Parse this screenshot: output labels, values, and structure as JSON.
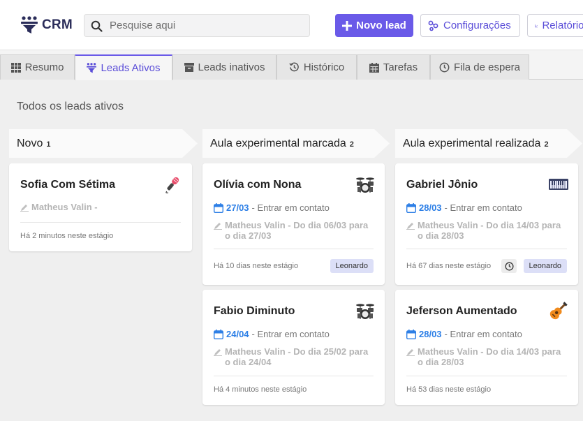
{
  "header": {
    "logo_text": "CRM",
    "search_placeholder": "Pesquise aqui",
    "new_lead_label": "Novo lead",
    "config_label": "Configurações",
    "reports_label": "Relatórios"
  },
  "tabs": [
    {
      "label": "Resumo",
      "icon": "grid-icon"
    },
    {
      "label": "Leads Ativos",
      "icon": "funnel-people-icon",
      "active": true
    },
    {
      "label": "Leads inativos",
      "icon": "archive-icon"
    },
    {
      "label": "Histórico",
      "icon": "history-icon"
    },
    {
      "label": "Tarefas",
      "icon": "calendar-icon"
    },
    {
      "label": "Fila de espera",
      "icon": "clock-icon"
    }
  ],
  "page_title": "Todos os leads ativos",
  "columns": [
    {
      "title": "Novo",
      "count": "1",
      "cards": [
        {
          "name": "Sofia Com Sétima",
          "icon": "microphone-icon",
          "owner": "Matheus Valin -",
          "footer": "Há 2 minutos neste estágio"
        }
      ]
    },
    {
      "title": "Aula experimental marcada",
      "count": "2",
      "cards": [
        {
          "name": "Olívia com Nona",
          "icon": "drums-icon",
          "date": "27/03",
          "action": "- Entrar em contato",
          "owner": "Matheus Valin - Do dia 06/03 para o dia 27/03",
          "footer": "Há 10 dias neste estágio",
          "badge": "Leonardo"
        },
        {
          "name": "Fabio Diminuto",
          "icon": "drums-icon",
          "date": "24/04",
          "action": "- Entrar em contato",
          "owner": "Matheus Valin - Do dia 25/02 para o dia 24/04",
          "footer": "Há 4 minutos neste estágio"
        }
      ]
    },
    {
      "title": "Aula experimental realizada",
      "count": "2",
      "cards": [
        {
          "name": "Gabriel Jônio",
          "icon": "keyboard-icon",
          "date": "28/03",
          "action": "- Entrar em contato",
          "owner": "Matheus Valin - Do dia 14/03 para o dia 28/03",
          "footer": "Há 67 dias neste estágio",
          "badge": "Leonardo",
          "has_clock": true
        },
        {
          "name": "Jeferson Aumentado",
          "icon": "guitar-icon",
          "date": "28/03",
          "action": "- Entrar em contato",
          "owner": "Matheus Valin - Do dia 14/03 para o dia 28/03",
          "footer": "Há 53 dias neste estágio"
        }
      ]
    }
  ],
  "colors": {
    "accent": "#6a5ae8",
    "date_blue": "#2d7fe6",
    "badge_bg": "#dcdff7"
  }
}
